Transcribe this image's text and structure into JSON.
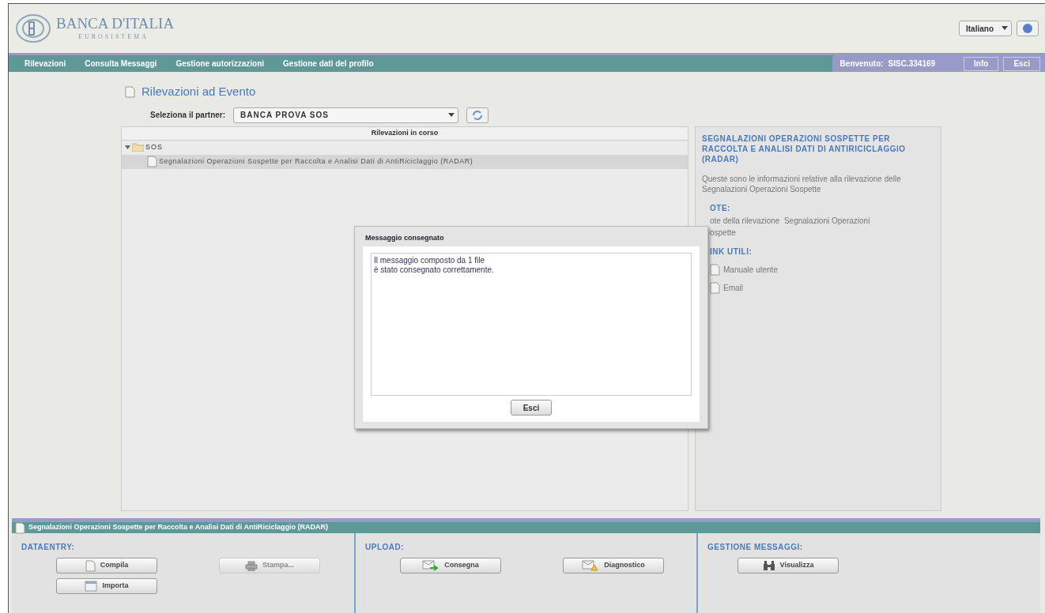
{
  "header": {
    "logo_title": "BANCA D'ITALIA",
    "logo_subtitle": "EUROSISTEMA",
    "language": "Italiano"
  },
  "nav": {
    "items": [
      "Rilevazioni",
      "Consulta Messaggi",
      "Gestione autorizzazioni",
      "Gestione dati del profilo"
    ],
    "welcome_label": "Benvenuto:",
    "user": "SISC.334169",
    "buttons": [
      "Info",
      "Esci"
    ]
  },
  "page": {
    "title": "Rilevazioni ad Evento",
    "partner_label": "Seleziona il partner:",
    "partner_value": "BANCA PROVA SOS"
  },
  "tree": {
    "header": "Rilevazioni in corso",
    "items": [
      {
        "label": "SOS",
        "expanded": true,
        "children": [
          {
            "label": "Segnalazioni Operazioni Sospette per Raccolta e Analisi Dati di AntiRiciclaggio (RADAR)",
            "selected": true
          }
        ]
      }
    ]
  },
  "info_panel": {
    "title": "SEGNALAZIONI OPERAZIONI SOSPETTE PER RACCOLTA E ANALISI DATI DI ANTIRICICLAGGIO (RADAR)",
    "description": "Queste sono le informazioni relative alla rilevazione delle Segnalazioni Operazioni Sospette",
    "sections": [
      {
        "kind": "text",
        "heading": "OTE:",
        "lines": [
          "ote della rilevazione  Segnalazioni Operazioni",
          "ospette"
        ]
      },
      {
        "kind": "links",
        "heading": "INK UTILI:",
        "lines": [
          "Manuale utente",
          "Email"
        ]
      }
    ]
  },
  "dialog": {
    "title": "Messaggio consegnato",
    "lines": [
      "Il messaggio composto da 1 file",
      "è stato consegnato correttamente."
    ],
    "button": "Esci"
  },
  "bottom": {
    "title": "Segnalazioni Operazioni Sospette per Raccolta e Analisi Dati di AntiRiciclaggio (RADAR)",
    "groups": [
      {
        "heading": "DATAENTRY:",
        "buttons": [
          {
            "kind": "document",
            "label": "Compila",
            "disabled": false
          },
          {
            "kind": "printer",
            "label": "Stampa...",
            "disabled": true
          },
          {
            "kind": "import",
            "label": "Importa",
            "disabled": false
          }
        ]
      },
      {
        "heading": "UPLOAD:",
        "buttons": [
          {
            "kind": "send",
            "label": "Consegna",
            "disabled": false
          },
          {
            "kind": "diagnostic",
            "label": "Diagnostico",
            "disabled": false
          }
        ]
      },
      {
        "heading": "GESTIONE MESSAGGI:",
        "buttons": [
          {
            "kind": "binoculars",
            "label": "Visualizza",
            "disabled": false
          }
        ]
      }
    ]
  }
}
